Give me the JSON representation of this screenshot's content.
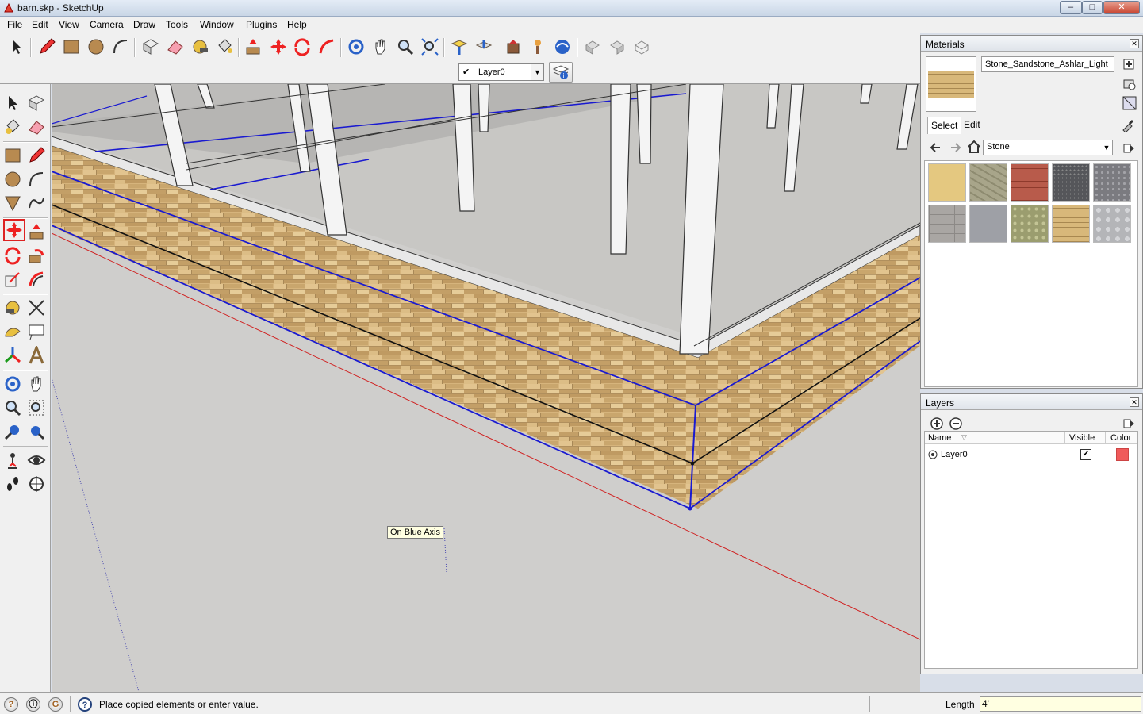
{
  "window": {
    "title": "barn.skp - SketchUp",
    "controls": {
      "minimize": "–",
      "maximize": "□",
      "close": "✕"
    }
  },
  "menu": [
    "File",
    "Edit",
    "View",
    "Camera",
    "Draw",
    "Tools",
    "Window",
    "Plugins",
    "Help"
  ],
  "toolbar": {
    "tools": [
      "select-icon",
      "pencil-icon",
      "rectangle-icon",
      "circle-icon",
      "arc-icon",
      "make-component-icon",
      "eraser-icon",
      "tape-measure-icon",
      "paint-bucket-icon",
      "push-pull-icon",
      "move-icon",
      "rotate-icon",
      "follow-me-icon",
      "orbit-icon",
      "pan-icon",
      "zoom-icon",
      "zoom-extents-icon",
      "get-models-icon",
      "share-model-icon",
      "get-components-icon",
      "share-component-icon",
      "google-earth-icon",
      "previous-view-icon",
      "next-view-icon",
      "toggle-terrain-icon"
    ]
  },
  "layer_toolbar": {
    "current_layer": "Layer0",
    "check": "✔"
  },
  "viewport": {
    "tooltip": "On Blue Axis"
  },
  "materials_panel": {
    "title": "Materials",
    "close": "✕",
    "material_name": "Stone_Sandstone_Ashlar_Light",
    "tabs": [
      "Select",
      "Edit"
    ],
    "library": "Stone",
    "swatches": [
      {
        "name": "sandstone-light",
        "color": "#e4c880"
      },
      {
        "name": "stone-mossy",
        "color": "#a8a58a"
      },
      {
        "name": "brick-red",
        "color": "#b85b4b"
      },
      {
        "name": "granite-dark",
        "color": "#55565a"
      },
      {
        "name": "granite-gray",
        "color": "#7b7b80"
      },
      {
        "name": "flagstone-gray",
        "color": "#a9a6a3"
      },
      {
        "name": "stone-blue-gray",
        "color": "#9ea0a6"
      },
      {
        "name": "stone-green",
        "color": "#9b9d6f"
      },
      {
        "name": "sandstone-ashlar-light",
        "color": "#d8b87a"
      },
      {
        "name": "marble-gray",
        "color": "#b4b5b8"
      }
    ]
  },
  "layers_panel": {
    "title": "Layers",
    "close": "✕",
    "columns": {
      "name": "Name",
      "visible": "Visible",
      "color": "Color"
    },
    "rows": [
      {
        "name": "Layer0",
        "visible": "✔",
        "color": "#f05a5a"
      }
    ]
  },
  "statusbar": {
    "message": "Place copied elements or enter value.",
    "vcb_label": "Length",
    "vcb_value": "4'",
    "help": "?"
  }
}
